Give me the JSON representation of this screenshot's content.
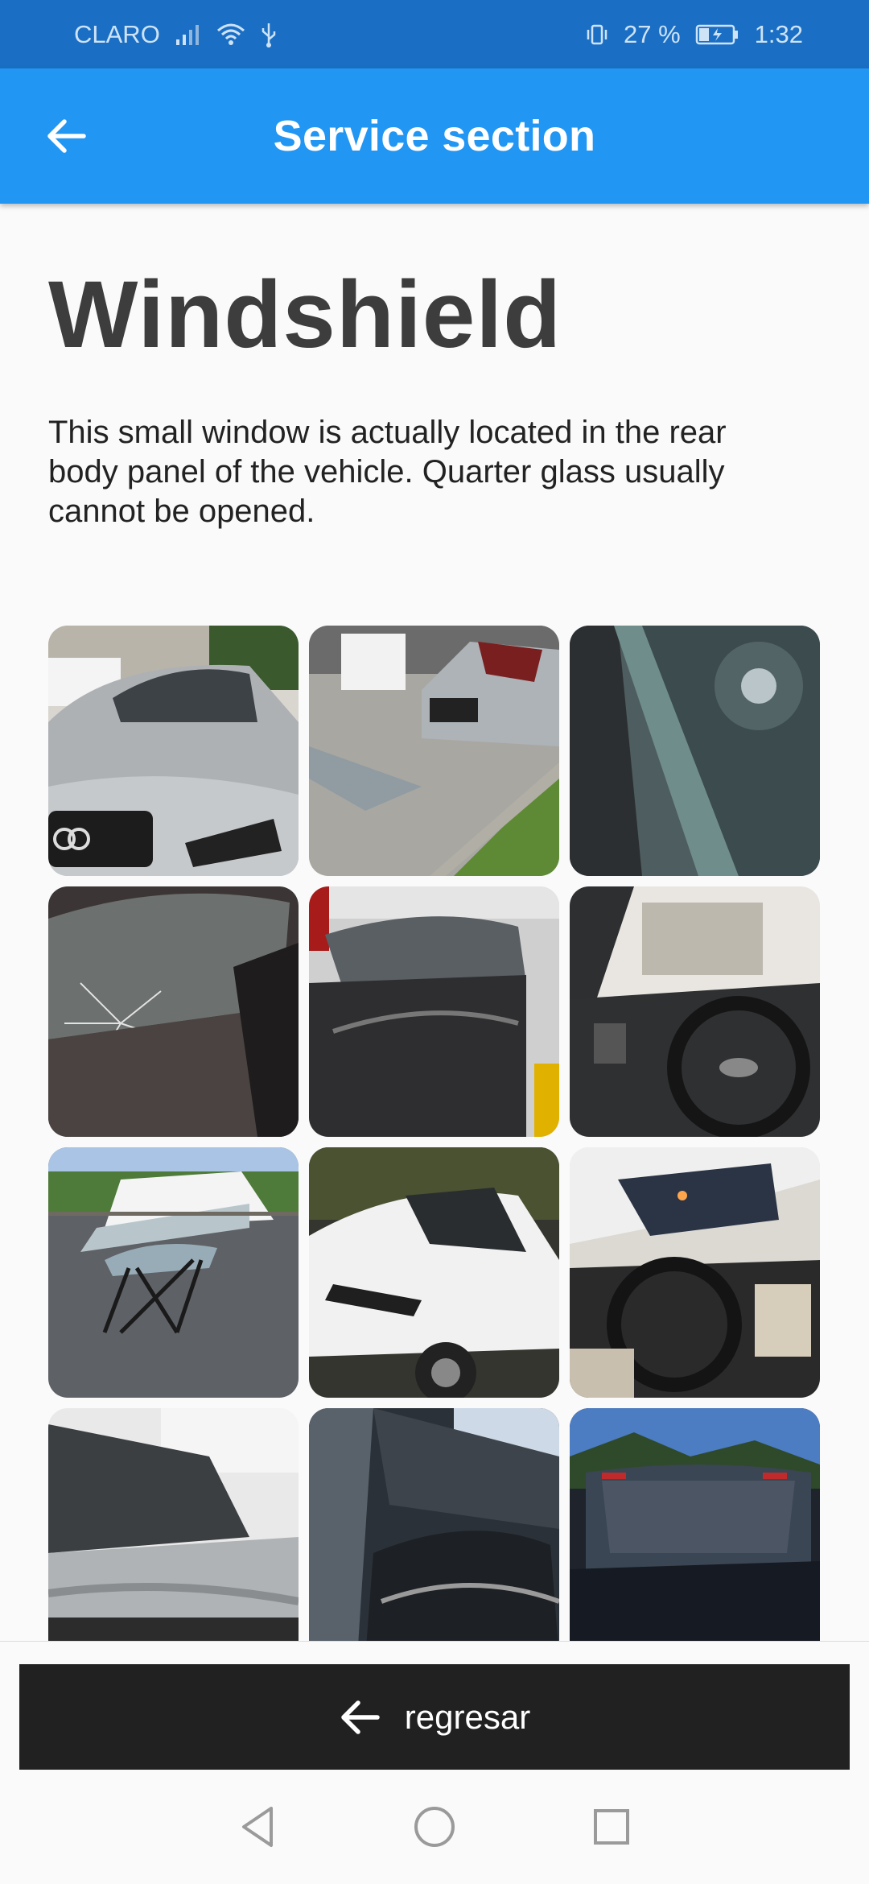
{
  "status_bar": {
    "carrier": "CLARO",
    "battery": "27 %",
    "time": "1:32"
  },
  "app_bar": {
    "title": "Service section",
    "back_icon": "arrow-left-icon"
  },
  "page": {
    "title": "Windshield",
    "description": "This small window is actually located in the rear body panel of the vehicle. Quarter glass usually cannot be opened."
  },
  "gallery": {
    "items": [
      {
        "name": "silver-audi-front-photo"
      },
      {
        "name": "silver-audi-glass-removed-photo"
      },
      {
        "name": "windshield-corner-closeup-photo"
      },
      {
        "name": "cracked-windshield-photo"
      },
      {
        "name": "black-car-windshield-photo"
      },
      {
        "name": "audi-dashboard-interior-photo"
      },
      {
        "name": "windshield-on-stand-photo"
      },
      {
        "name": "white-range-rover-photo"
      },
      {
        "name": "range-rover-interior-photo"
      },
      {
        "name": "car-side-window-photo"
      },
      {
        "name": "car-open-windshield-frame-photo"
      },
      {
        "name": "dark-suv-windshield-photo"
      }
    ]
  },
  "bottom_button": {
    "label": "regresar",
    "icon": "arrow-left-icon"
  },
  "nav_bar": {
    "back_icon": "triangle-back-icon",
    "home_icon": "circle-home-icon",
    "recents_icon": "square-recents-icon"
  },
  "colors": {
    "app_bar": "#2196f3",
    "status_bar": "#1a6fc4",
    "bottom_button": "#212121",
    "title_text": "#3d3d3d"
  }
}
